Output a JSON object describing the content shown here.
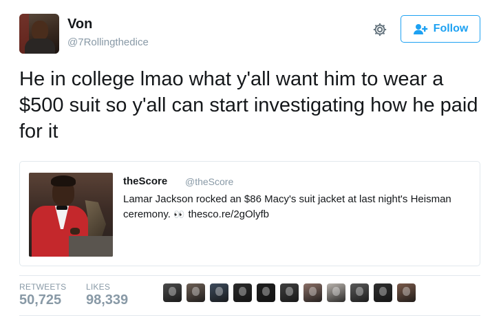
{
  "author": {
    "display_name": "Von",
    "screen_name": "@7Rollingthedice",
    "avatar_icon": "avatar"
  },
  "actions": {
    "settings_icon": "gear-icon",
    "follow_label": "Follow",
    "follow_icon": "add-user-icon",
    "accent_color": "#1da1f2"
  },
  "tweet": {
    "text": "He in college lmao what y'all want him to wear a $500 suit so y'all can start investigating how he paid for it"
  },
  "quoted_tweet": {
    "display_name": "theScore",
    "screen_name": "@theScore",
    "text_before": "Lamar Jackson rocked an $86 Macy's suit jacket at last night's Heisman ceremony.",
    "emoji": "👀",
    "link": "thesco.re/2gOlyfb"
  },
  "stats": {
    "retweets_label": "RETWEETS",
    "retweets_count": "50,725",
    "likes_label": "LIKES",
    "likes_count": "98,339"
  },
  "likers": [
    {
      "color": "#4a4a4a"
    },
    {
      "color": "#6d5f55"
    },
    {
      "color": "#3d4b5c"
    },
    {
      "color": "#2a2a2a"
    },
    {
      "color": "#1f1f1f"
    },
    {
      "color": "#3f3f3f"
    },
    {
      "color": "#8a6f66"
    },
    {
      "color": "#b9b3ad"
    },
    {
      "color": "#595959"
    },
    {
      "color": "#2f2f2f"
    },
    {
      "color": "#7a5a4a"
    }
  ]
}
